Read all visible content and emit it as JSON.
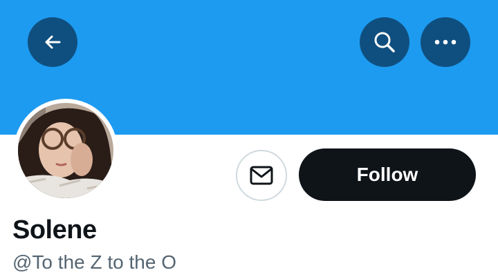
{
  "profile": {
    "display_name": "Solene",
    "handle": "@To the Z to the O"
  },
  "header": {
    "back_icon": "arrow-left-icon",
    "search_icon": "search-icon",
    "more_icon": "more-horizontal-icon"
  },
  "actions": {
    "message_icon": "envelope-icon",
    "follow_label": "Follow"
  },
  "colors": {
    "banner": "#1d9bf0",
    "header_button": "#0f4f7f",
    "follow_button": "#0f1419",
    "handle_text": "#536471"
  }
}
